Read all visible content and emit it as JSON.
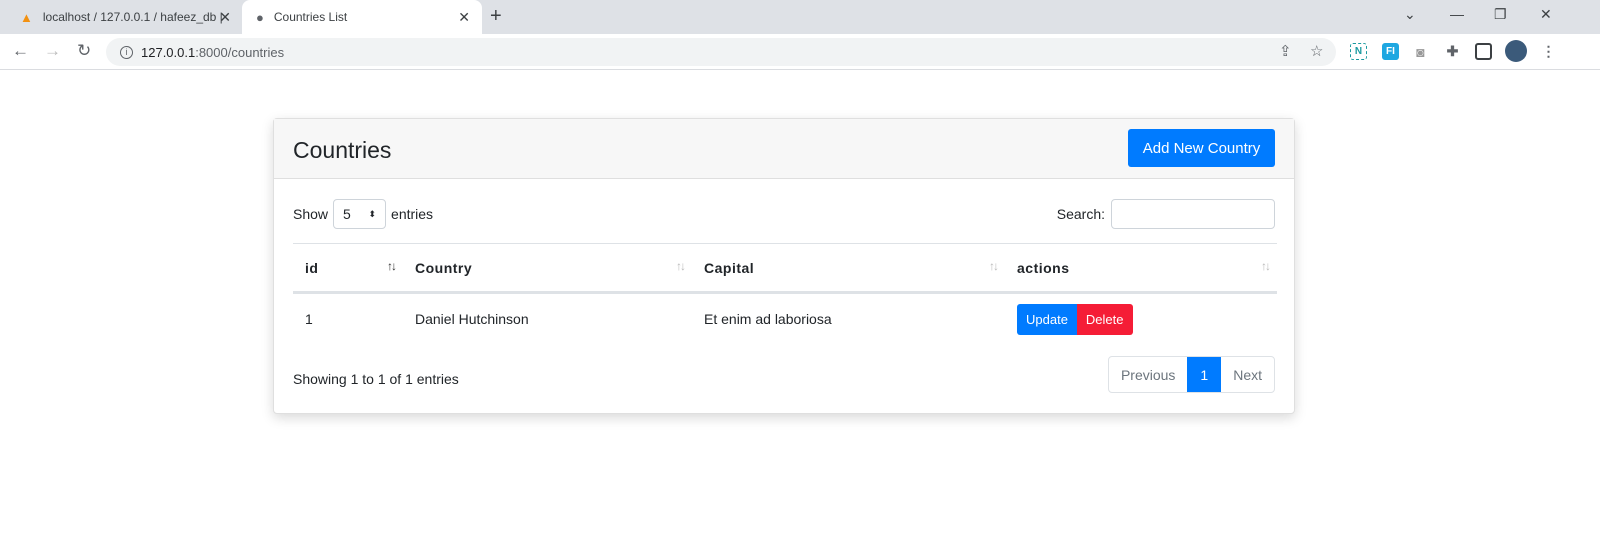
{
  "browser": {
    "tabs": [
      {
        "title": "localhost / 127.0.0.1 / hafeez_db |",
        "icon": "phpmyadmin-icon"
      },
      {
        "title": "Countries List",
        "icon": "globe-icon"
      }
    ],
    "url_host": "127.0.0.1",
    "url_path": ":8000/countries"
  },
  "card": {
    "title": "Countries",
    "add_button": "Add New Country",
    "show_label": "Show",
    "entries_value": "5",
    "entries_label": "entries",
    "search_label": "Search:",
    "search_value": ""
  },
  "table": {
    "columns": [
      "id",
      "Country",
      "Capital",
      "actions"
    ],
    "rows": [
      {
        "id": "1",
        "country": "Daniel Hutchinson",
        "capital": "Et enim ad laboriosa",
        "update": "Update",
        "delete": "Delete"
      }
    ]
  },
  "footer": {
    "info": "Showing 1 to 1 of 1 entries",
    "previous": "Previous",
    "page": "1",
    "next": "Next"
  },
  "colors": {
    "primary": "#007bff",
    "danger": "#f51d36"
  }
}
